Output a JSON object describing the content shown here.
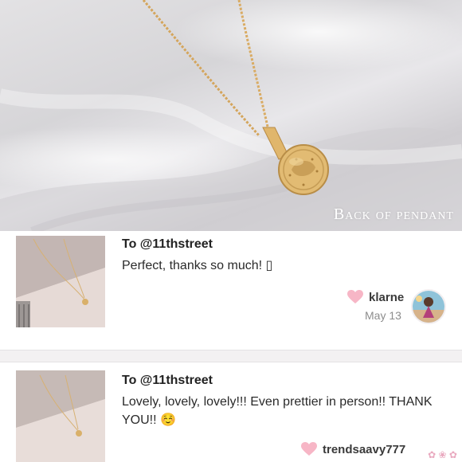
{
  "hero": {
    "caption": "Back of pendant",
    "icon": "coin-pendant-necklace-photo"
  },
  "reviews": [
    {
      "to": "To @11thstreet",
      "message": "Perfect, thanks so much! ▯",
      "username": "klarne",
      "date": "May 13",
      "thumb_icon": "necklace-thumbnail",
      "avatar_icon": "user-avatar"
    },
    {
      "to": "To @11thstreet",
      "message": "Lovely, lovely, lovely!!! Even prettier in person!! THANK YOU!! ☺️",
      "username": "trendsaavy777",
      "thumb_icon": "necklace-thumbnail"
    }
  ],
  "colors": {
    "heart": "#f7b6c6",
    "gold": "#d9b06a",
    "card_bg": "#ffffff",
    "page_bg": "#f3f1f2"
  }
}
